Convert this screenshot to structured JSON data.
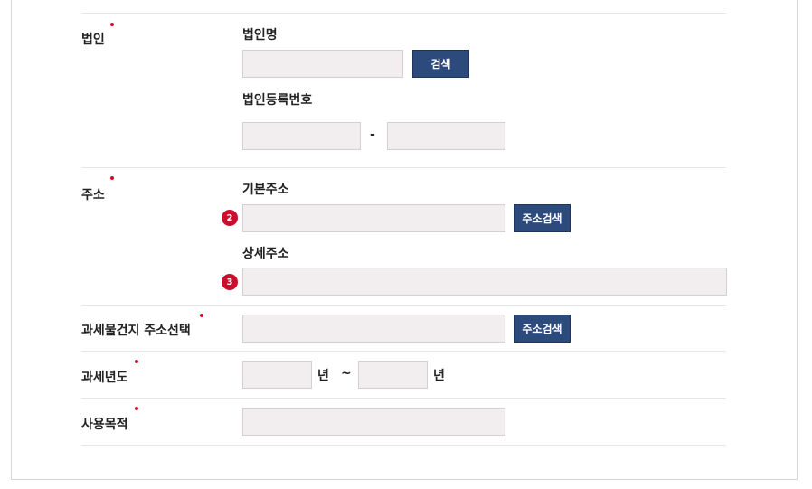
{
  "corporation": {
    "label": "법인",
    "name_label": "법인명",
    "name_value": "",
    "search_button": "검색",
    "reg_label": "법인등록번호",
    "reg_part1": "",
    "reg_part2": "",
    "reg_separator": "-"
  },
  "address": {
    "label": "주소",
    "basic_label": "기본주소",
    "basic_step": "2",
    "basic_value": "",
    "search_button": "주소검색",
    "detail_label": "상세주소",
    "detail_step": "3",
    "detail_value": ""
  },
  "property_address": {
    "label": "과세물건지 주소선택",
    "value": "",
    "search_button": "주소검색"
  },
  "tax_year": {
    "label": "과세년도",
    "from_value": "",
    "from_unit": "년",
    "range_separator": "~",
    "to_value": "",
    "to_unit": "년"
  },
  "purpose": {
    "label": "사용목적",
    "value": ""
  },
  "colors": {
    "required_dot": "#c8102e",
    "button_bg": "#2c4a7c",
    "input_bg": "#f2eef0",
    "step_badge": "#c8102e"
  }
}
